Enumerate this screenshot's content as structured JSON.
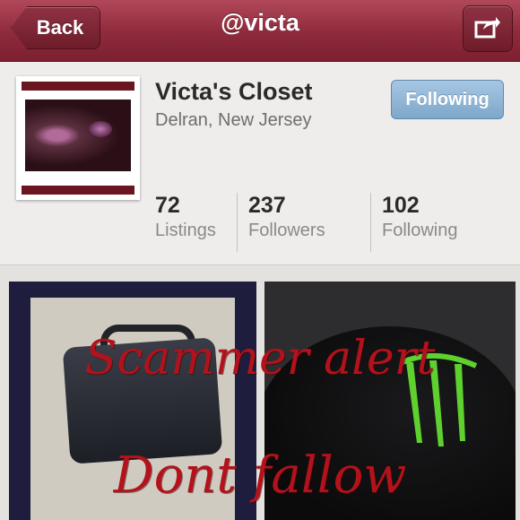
{
  "navbar": {
    "back_label": "Back",
    "title": "@victa",
    "share_icon": "share-icon"
  },
  "profile": {
    "name": "Victa's Closet",
    "location": "Delran, New Jersey",
    "follow_button": "Following",
    "stats": [
      {
        "value": "72",
        "label": "Listings"
      },
      {
        "value": "237",
        "label": "Followers"
      },
      {
        "value": "102",
        "label": "Following"
      }
    ]
  },
  "overlay": {
    "line1": "Scammer alert",
    "line2": "Dont fallow"
  },
  "colors": {
    "navbar": "#8e2a3b",
    "follow_button": "#8fb5d6",
    "overlay_text": "#b3121c"
  }
}
